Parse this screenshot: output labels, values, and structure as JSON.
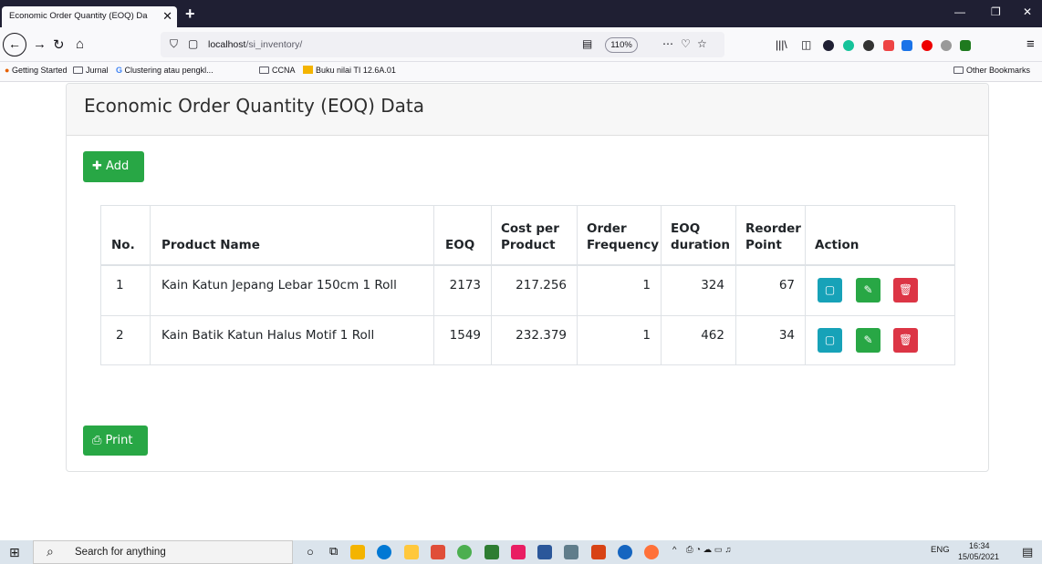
{
  "browser": {
    "tab_title": "Economic Order Quantity (EOQ) Da",
    "url_host": "localhost",
    "url_path": "/si_inventory/",
    "zoom": "110%",
    "bookmarks": [
      "Getting Started",
      "Jurnal",
      "Clustering atau pengkl...",
      "CCNA",
      "Buku nilai TI 12.6A.01"
    ],
    "other_bookmarks": "Other Bookmarks"
  },
  "page": {
    "title": "Economic Order Quantity (EOQ) Data",
    "add_label": "Add",
    "print_label": "Print"
  },
  "table": {
    "headers": {
      "no": "No.",
      "product": "Product Name",
      "eoq": "EOQ",
      "cost_1": "Cost per",
      "cost_2": "Product",
      "freq_1": "Order",
      "freq_2": "Frequency",
      "dur_1": "EOQ",
      "dur_2": "duration",
      "reorder_1": "Reorder",
      "reorder_2": "Point",
      "action": "Action"
    },
    "rows": [
      {
        "no": "1",
        "product": "Kain Katun Jepang Lebar 150cm 1 Roll",
        "eoq": "2173",
        "cost": "217.256",
        "freq": "1",
        "duration": "324",
        "reorder": "67"
      },
      {
        "no": "2",
        "product": "Kain Batik Katun Halus Motif 1 Roll",
        "eoq": "1549",
        "cost": "232.379",
        "freq": "1",
        "duration": "462",
        "reorder": "34"
      }
    ]
  },
  "taskbar": {
    "search_placeholder": "Search for anything",
    "lang": "ENG",
    "time": "16:34",
    "date": "15/05/2021"
  },
  "icons": {
    "add": "plus-icon",
    "print": "printer-icon",
    "detail": "detail-icon",
    "edit": "edit-icon",
    "delete": "trash-icon"
  },
  "colors": {
    "success": "#28a745",
    "info": "#17a2b8",
    "danger": "#dc3545"
  }
}
